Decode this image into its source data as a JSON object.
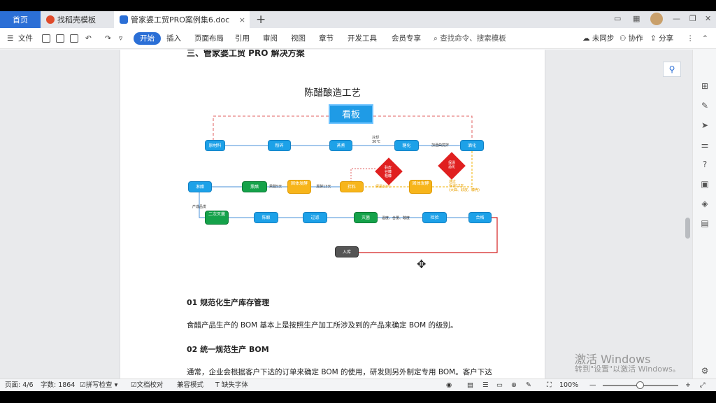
{
  "tabs": {
    "home": "首页",
    "template": "找稻壳模板",
    "document": "管家婆工贸PRO案例集6.doc",
    "plus": "+"
  },
  "ribbon": {
    "file": "文件",
    "items": [
      "开始",
      "插入",
      "页面布局",
      "引用",
      "审阅",
      "视图",
      "章节",
      "开发工具",
      "会员专享"
    ],
    "search_placeholder": "查找命令、搜索模板",
    "sync": "未同步",
    "collab": "协作",
    "share": "分享"
  },
  "document": {
    "cut_heading": "三、管家婆工贸 PRO 解决方案",
    "chart_title": "陈醋酿造工艺",
    "kanban": "看板",
    "nodes_row1": [
      "原材料",
      "粉碎",
      "蒸煮",
      "糖化",
      "酒化"
    ],
    "label_cool": "冷却\n30℃",
    "label_yeast": "加酒曲搅拌",
    "nodes_row2": [
      "淋醋",
      "熏醋",
      "固体发酵",
      "拌料",
      "固体发酵"
    ],
    "label_smoke": "熏醋5天",
    "label_ferment": "发酵13天",
    "label_temp": "保温32℃",
    "label_hint": "通过\n保温12天\n(大曲、麸皮、糠壳)",
    "diamond_1": "麸皮\n谷糠\n粗糠",
    "diamond_2": "保温\n酒化",
    "label_mature": "产成品发",
    "nodes_row3": [
      "二次灭菌",
      "陈酿",
      "过滤",
      "灭菌",
      "检验",
      "合格"
    ],
    "label_test": "温度、含量、酸度",
    "node_store": "入库",
    "section1": "01 规范化生产库存管理",
    "para1": "食醋产品生产的 BOM 基本上是按照生产加工所涉及到的产品来确定 BOM 的级别。",
    "section2": "02 统一规范生产 BOM",
    "para2": "通常，企业会根据客户下达的订单来确定 BOM 的使用，研发则另外制定专用 BOM。客户下达"
  },
  "watermark": {
    "line1": "激活 Windows",
    "line2": "转到\"设置\"以激活 Windows。"
  },
  "status": {
    "page": "页面: 4/6",
    "words": "字数: 1864",
    "spell": "拼写检查",
    "proof": "文档校对",
    "compat": "兼容模式",
    "font": "缺失字体",
    "zoom": "100%"
  },
  "colors": {
    "accent": "#2b6fd6",
    "node_blue": "#1da1e8",
    "node_yellow": "#f7b51b",
    "node_green": "#15a24a",
    "flow_red": "#d42020"
  }
}
